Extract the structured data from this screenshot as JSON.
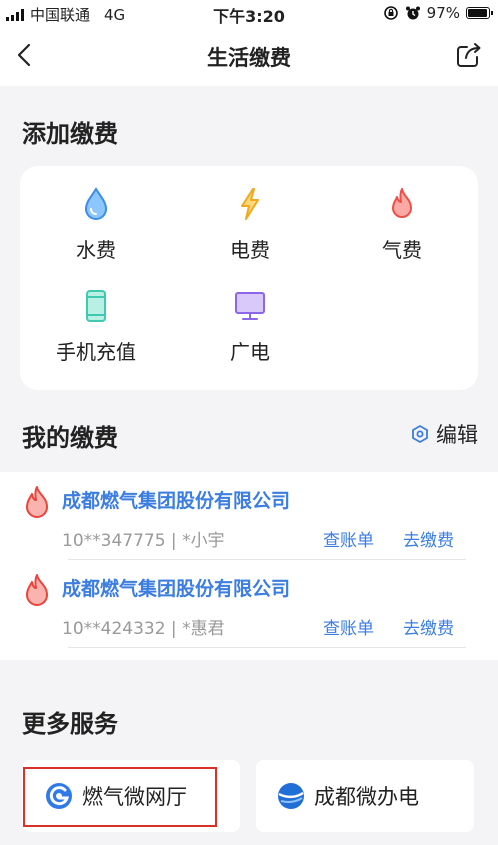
{
  "status": {
    "carrier": "中国联通",
    "network": "4G",
    "time": "下午3:20",
    "battery": "97%",
    "battery_level": 0.97
  },
  "nav": {
    "title": "生活缴费",
    "back_icon": "chevron-left-icon",
    "share_icon": "share-icon"
  },
  "add_section": {
    "title": "添加缴费",
    "items": [
      {
        "label": "水费",
        "icon": "water-drop-icon",
        "color": "#4a9ff5"
      },
      {
        "label": "电费",
        "icon": "lightning-icon",
        "color": "#f5b63a"
      },
      {
        "label": "气费",
        "icon": "flame-icon",
        "color": "#f0605a"
      },
      {
        "label": "手机充值",
        "icon": "mobile-phone-icon",
        "color": "#5fd4c0"
      },
      {
        "label": "广电",
        "icon": "tv-monitor-icon",
        "color": "#9b7ae8"
      }
    ]
  },
  "my_section": {
    "title": "我的缴费",
    "edit_label": "编辑",
    "bills": [
      {
        "company": "成都燃气集团股份有限公司",
        "account": "10**347775 | *小宇",
        "view_bill": "查账单",
        "pay": "去缴费"
      },
      {
        "company": "成都燃气集团股份有限公司",
        "account": "10**424332 | *惠君",
        "view_bill": "查账单",
        "pay": "去缴费"
      }
    ]
  },
  "more_section": {
    "title": "更多服务",
    "services": [
      {
        "label": "燃气微网厅",
        "icon": "gas-hall-logo-icon"
      },
      {
        "label": "成都微办电",
        "icon": "globe-logo-icon"
      }
    ]
  },
  "colors": {
    "accent": "#3b7de0",
    "highlight": "#d9302a",
    "flame": "#f0605a"
  }
}
